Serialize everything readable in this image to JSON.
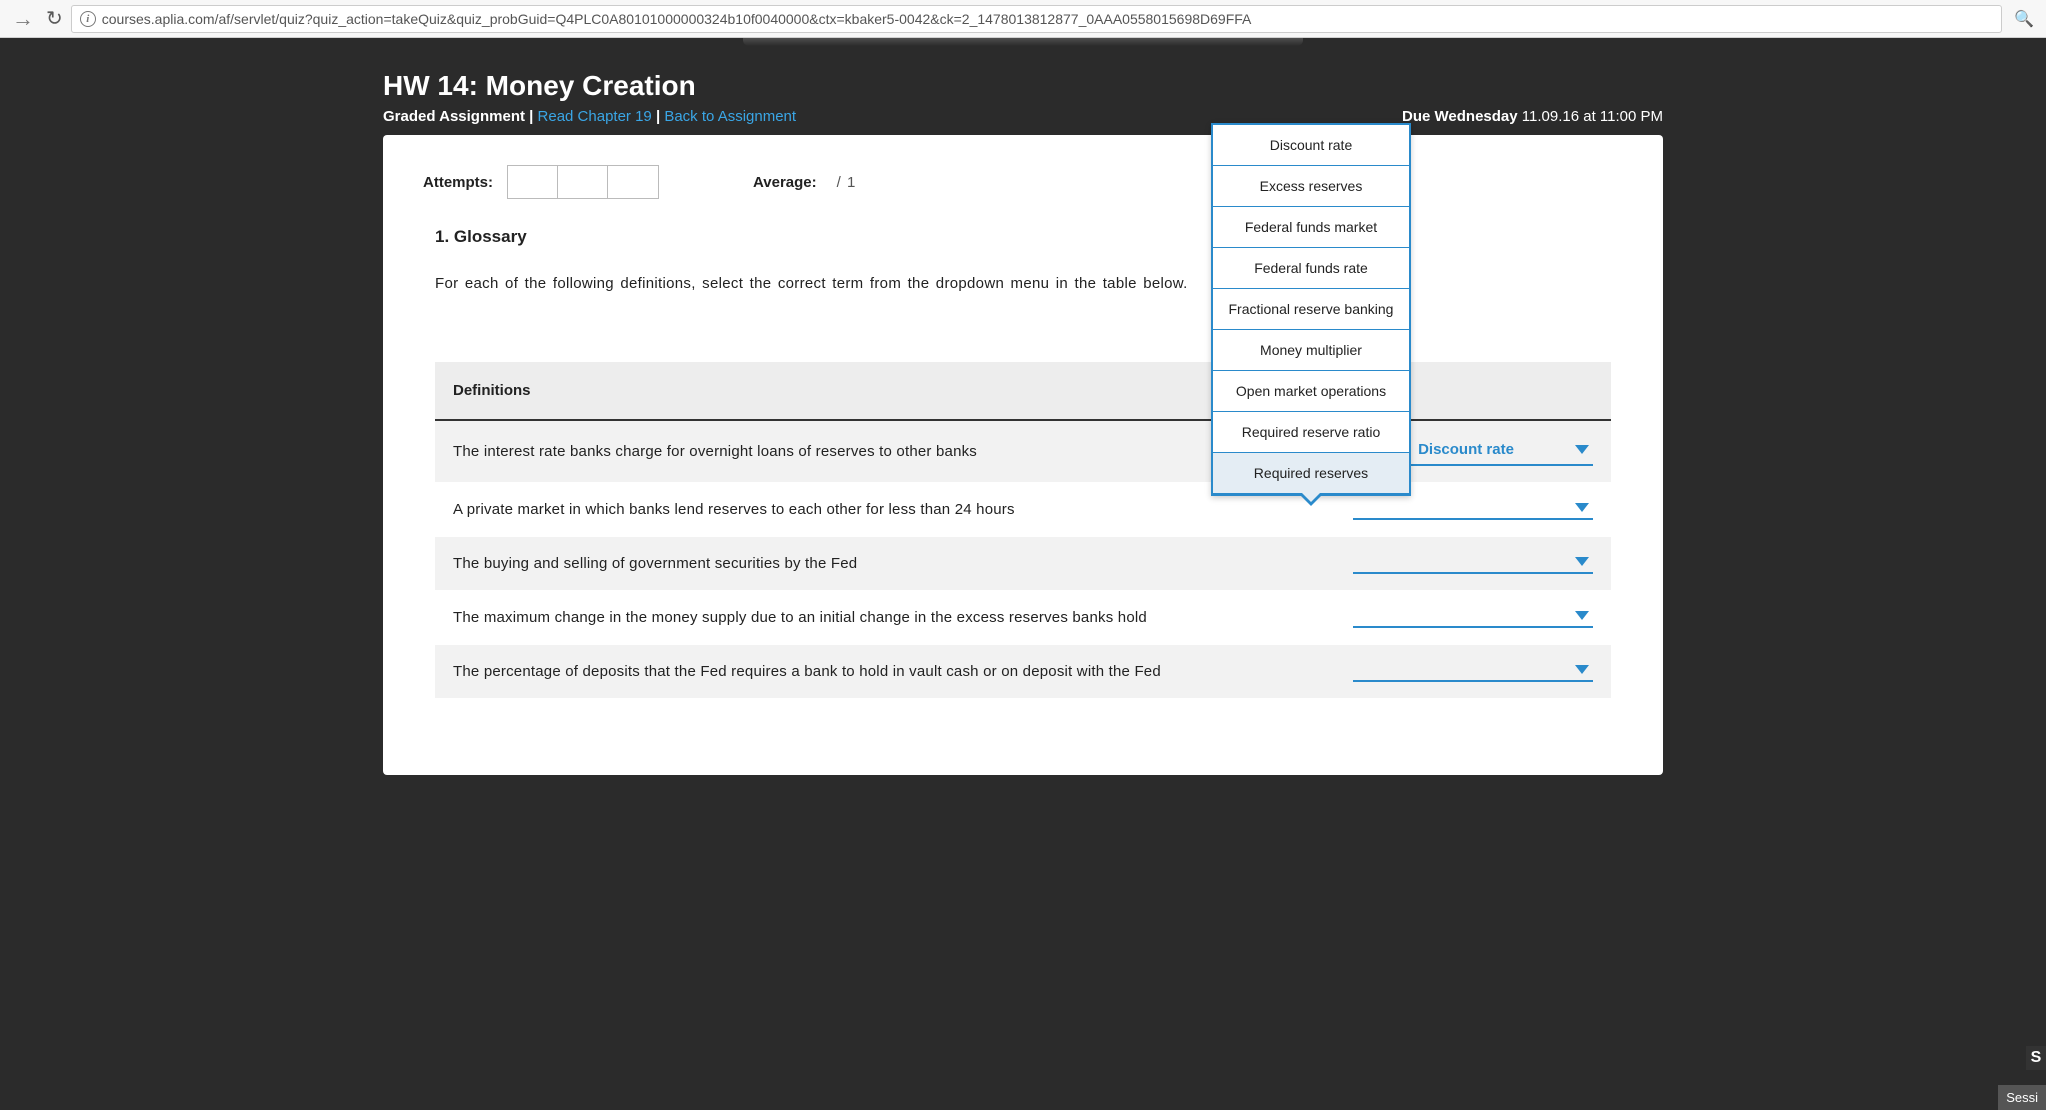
{
  "browser": {
    "url": "courses.aplia.com/af/servlet/quiz?quiz_action=takeQuiz&quiz_probGuid=Q4PLC0A80101000000324b10f0040000&ctx=kbaker5-0042&ck=2_1478013812877_0AAA0558015698D69FFA"
  },
  "header": {
    "title": "HW 14: Money Creation",
    "graded_label": "Graded Assignment",
    "read_link": "Read Chapter 19",
    "back_link": "Back to Assignment",
    "due_prefix": "Due",
    "due_day": "Wednesday",
    "due_date": "11.09.16 at 11:00 PM"
  },
  "attempts": {
    "label": "Attempts:",
    "avg_label": "Average:",
    "avg_value": "/ 1"
  },
  "question": {
    "number_title": "1. Glossary",
    "instruction": "For each of the following definitions, select the correct term from the dropdown menu in the table below."
  },
  "table": {
    "header": "Definitions",
    "rows": [
      {
        "text": "The interest rate banks charge for overnight loans of reserves to other banks",
        "selected": "Discount rate"
      },
      {
        "text": "A private market in which banks lend reserves to each other for less than 24 hours",
        "selected": ""
      },
      {
        "text": "The buying and selling of government securities by the Fed",
        "selected": ""
      },
      {
        "text": "The maximum change in the money supply due to an initial change in the excess reserves banks hold",
        "selected": ""
      },
      {
        "text": "The percentage of deposits that the Fed requires a bank to hold in vault cash or on deposit with the Fed",
        "selected": ""
      }
    ]
  },
  "dropdown_options": [
    "Discount rate",
    "Excess reserves",
    "Federal funds market",
    "Federal funds rate",
    "Fractional reserve banking",
    "Money multiplier",
    "Open market operations",
    "Required reserve ratio",
    "Required reserves"
  ],
  "dropdown_highlight_index": 8,
  "footer": {
    "session": "Sessi",
    "s": "S"
  }
}
